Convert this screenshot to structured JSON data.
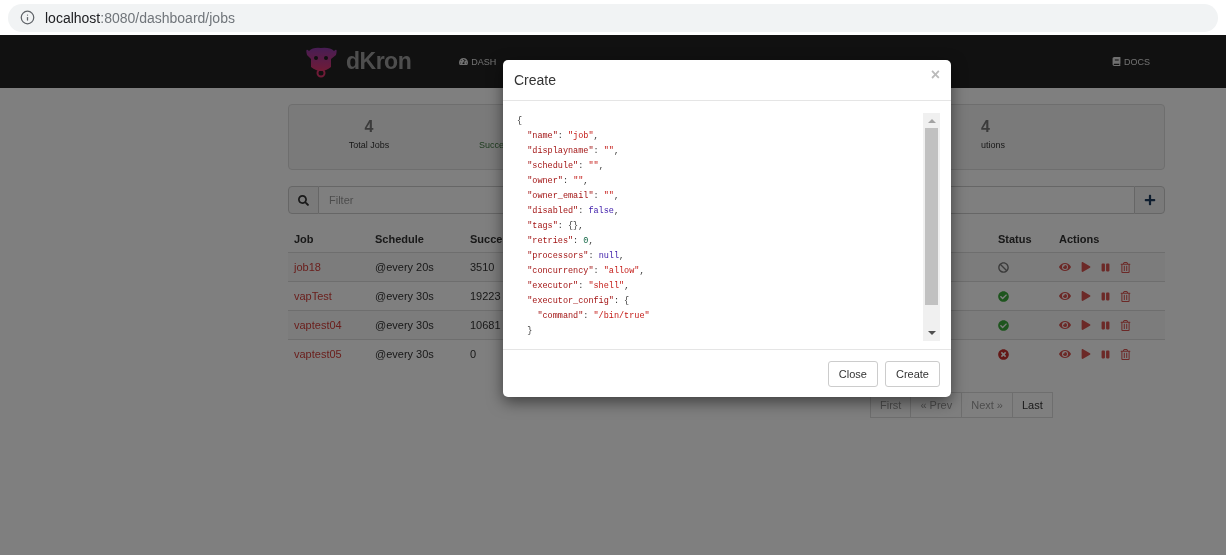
{
  "browser": {
    "address": {
      "host": "localhost",
      "path": ":8080/dashboard/jobs"
    }
  },
  "navbar": {
    "brand": "dKron",
    "items": [
      {
        "label": "DASH"
      }
    ],
    "docs": "DOCS"
  },
  "stats": [
    {
      "kind": "total",
      "value": "4",
      "label": "Total Jobs"
    },
    {
      "kind": "success",
      "label": "Succe"
    },
    {
      "kind": "executions",
      "value": "4",
      "label": "utions"
    }
  ],
  "filter": {
    "placeholder": "Filter"
  },
  "table": {
    "columns": [
      "Job",
      "Schedule",
      "Succe",
      "Status",
      "Actions"
    ],
    "rows": [
      {
        "job": "job18",
        "schedule": "@every 20s",
        "success_count": "3510",
        "status": {
          "kind": "disabled"
        }
      },
      {
        "job": "vapTest",
        "schedule": "@every 30s",
        "success_count": "19223",
        "status": {
          "kind": "success"
        }
      },
      {
        "job": "vaptest04",
        "schedule": "@every 30s",
        "success_count": "10681",
        "status": {
          "kind": "success"
        }
      },
      {
        "job": "vaptest05",
        "schedule": "@every 30s",
        "success_count": "0",
        "status": {
          "kind": "failed"
        }
      }
    ]
  },
  "pagination": [
    {
      "label": "First",
      "disabled": true
    },
    {
      "label": "« Prev",
      "disabled": true
    },
    {
      "label": "Next »",
      "disabled": true
    },
    {
      "label": "Last",
      "disabled": false
    }
  ],
  "modal": {
    "title": "Create",
    "close": "×",
    "code": [
      [
        {
          "kind": "punct",
          "text": "{"
        }
      ],
      [
        {
          "kind": "key",
          "text": "  \"name\""
        },
        {
          "kind": "punct",
          "text": ": "
        },
        {
          "kind": "string",
          "text": "\"job\""
        },
        {
          "kind": "punct",
          "text": ","
        }
      ],
      [
        {
          "kind": "key",
          "text": "  \"displayname\""
        },
        {
          "kind": "punct",
          "text": ": "
        },
        {
          "kind": "string",
          "text": "\"\""
        },
        {
          "kind": "punct",
          "text": ","
        }
      ],
      [
        {
          "kind": "key",
          "text": "  \"schedule\""
        },
        {
          "kind": "punct",
          "text": ": "
        },
        {
          "kind": "string",
          "text": "\"\""
        },
        {
          "kind": "punct",
          "text": ","
        }
      ],
      [
        {
          "kind": "key",
          "text": "  \"owner\""
        },
        {
          "kind": "punct",
          "text": ": "
        },
        {
          "kind": "string",
          "text": "\"\""
        },
        {
          "kind": "punct",
          "text": ","
        }
      ],
      [
        {
          "kind": "key",
          "text": "  \"owner_email\""
        },
        {
          "kind": "punct",
          "text": ": "
        },
        {
          "kind": "string",
          "text": "\"\""
        },
        {
          "kind": "punct",
          "text": ","
        }
      ],
      [
        {
          "kind": "key",
          "text": "  \"disabled\""
        },
        {
          "kind": "punct",
          "text": ": "
        },
        {
          "kind": "atom",
          "text": "false"
        },
        {
          "kind": "punct",
          "text": ","
        }
      ],
      [
        {
          "kind": "key",
          "text": "  \"tags\""
        },
        {
          "kind": "punct",
          "text": ": {},"
        }
      ],
      [
        {
          "kind": "key",
          "text": "  \"retries\""
        },
        {
          "kind": "punct",
          "text": ": "
        },
        {
          "kind": "number",
          "text": "0"
        },
        {
          "kind": "punct",
          "text": ","
        }
      ],
      [
        {
          "kind": "key",
          "text": "  \"processors\""
        },
        {
          "kind": "punct",
          "text": ": "
        },
        {
          "kind": "atom",
          "text": "null"
        },
        {
          "kind": "punct",
          "text": ","
        }
      ],
      [
        {
          "kind": "key",
          "text": "  \"concurrency\""
        },
        {
          "kind": "punct",
          "text": ": "
        },
        {
          "kind": "string",
          "text": "\"allow\""
        },
        {
          "kind": "punct",
          "text": ","
        }
      ],
      [
        {
          "kind": "key",
          "text": "  \"executor\""
        },
        {
          "kind": "punct",
          "text": ": "
        },
        {
          "kind": "string",
          "text": "\"shell\""
        },
        {
          "kind": "punct",
          "text": ","
        }
      ],
      [
        {
          "kind": "key",
          "text": "  \"executor_config\""
        },
        {
          "kind": "punct",
          "text": ": {"
        }
      ],
      [
        {
          "kind": "key",
          "text": "    \"command\""
        },
        {
          "kind": "punct",
          "text": ": "
        },
        {
          "kind": "string",
          "text": "\"/bin/true\""
        }
      ],
      [
        {
          "kind": "punct",
          "text": "  }"
        }
      ]
    ],
    "buttons": [
      "Close",
      "Create"
    ]
  }
}
